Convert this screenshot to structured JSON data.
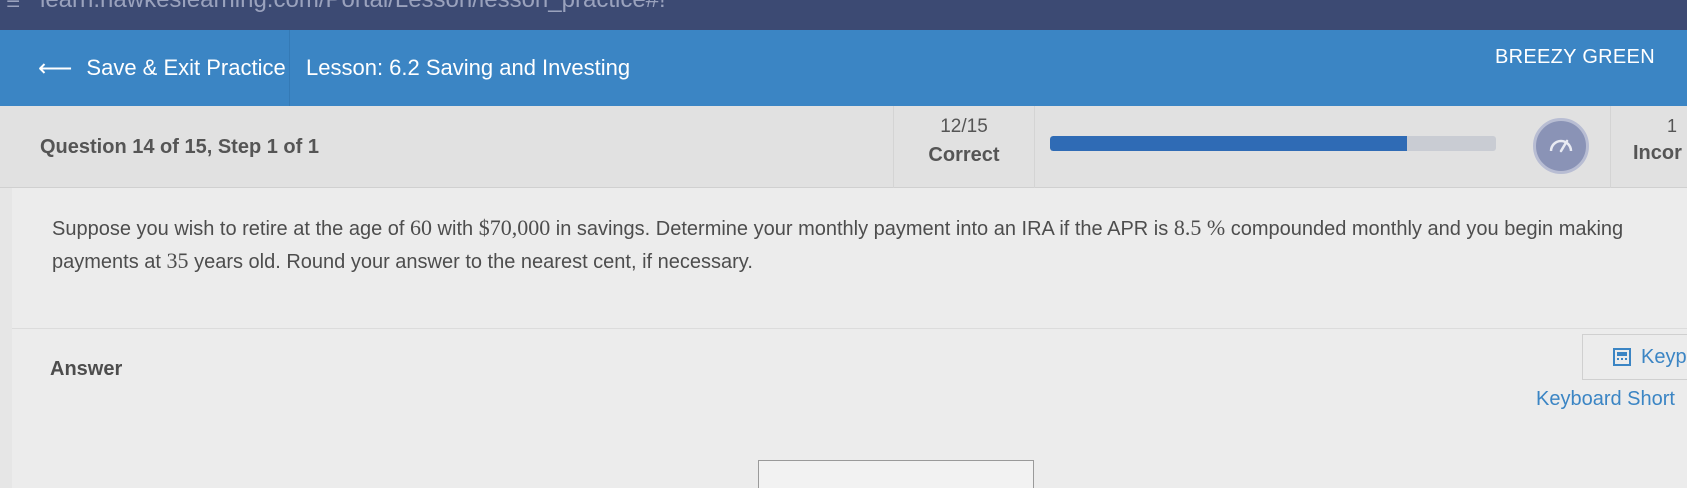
{
  "browser": {
    "url": "learn.hawkeslearning.com/Portal/Lesson/lesson_practice#!"
  },
  "topbar": {
    "exit_label": "Save & Exit Practice",
    "lesson_title": "Lesson: 6.2 Saving and Investing",
    "user_name": "BREEZY GREEN"
  },
  "progress": {
    "step_label": "Question 14 of 15, Step 1 of 1",
    "score_fraction": "12/15",
    "score_label": "Correct",
    "progress_fraction": 0.8,
    "incorrect_count": "1",
    "incorrect_label": "Incor"
  },
  "question": {
    "part1": "Suppose you wish to retire at the age of ",
    "age": "60",
    "part2": " with ",
    "savings": "$70,000",
    "part3": " in savings. Determine your monthly payment into an IRA if the APR is ",
    "apr": "8.5 %",
    "part4": " compounded monthly and you begin making payments at ",
    "start_age": "35",
    "part5": " years old. Round your answer to the nearest cent, if necessary."
  },
  "answer": {
    "label": "Answer",
    "keypad_label": "Keyp",
    "keyboard_shortcuts_label": "Keyboard Short",
    "value": ""
  },
  "colors": {
    "brand_blue": "#3b85c4",
    "progress_fill": "#2f6bb5"
  }
}
